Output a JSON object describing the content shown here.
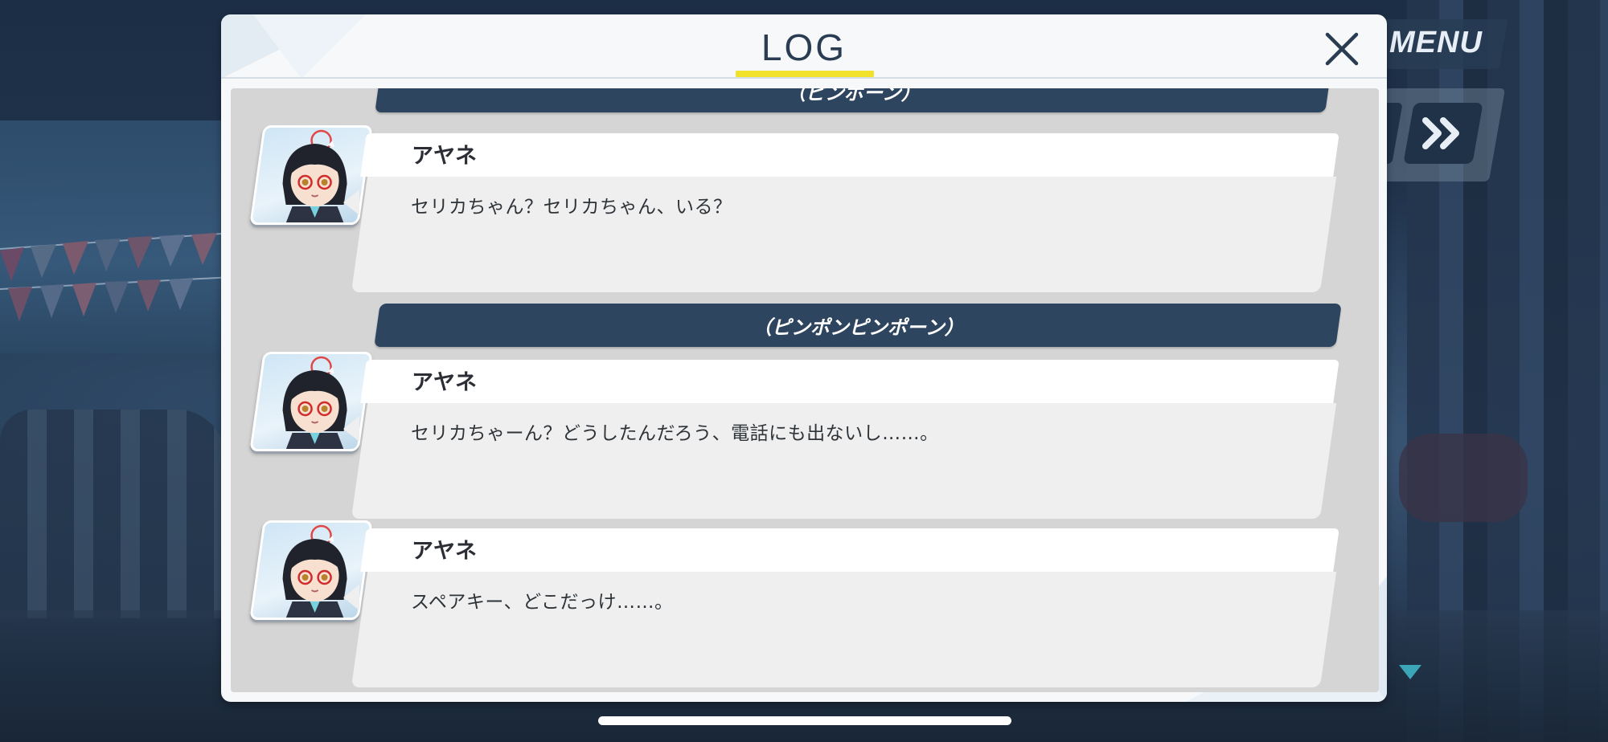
{
  "hud": {
    "menu_label": "MENU",
    "fast_forward_icon": "fast-forward-icon"
  },
  "dialog": {
    "title": "LOG",
    "close_icon": "close-icon"
  },
  "log": {
    "narration_1": "（ピンポーン）",
    "entry_1": {
      "speaker": "アヤネ",
      "text": "セリカちゃん？セリカちゃん、いる？"
    },
    "narration_2": "（ピンポンピンポーン）",
    "entry_2": {
      "speaker": "アヤネ",
      "text": "セリカちゃーん？どうしたんだろう、電話にも出ないし……。"
    },
    "entry_3": {
      "speaker": "アヤネ",
      "text": "スペアキー、どこだっけ……。"
    }
  },
  "colors": {
    "title_underline": "#f2e22c",
    "narration_bg": "#2e4560",
    "dialog_bg": "#f6f8fa"
  }
}
